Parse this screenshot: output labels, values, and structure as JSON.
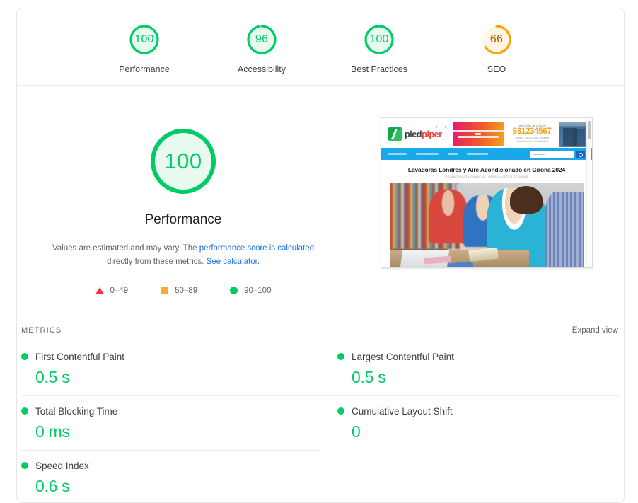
{
  "categories": [
    {
      "label": "Performance",
      "score": "100",
      "value": 100,
      "color": "#0c6",
      "track": "#e8f9ef"
    },
    {
      "label": "Accessibility",
      "score": "96",
      "value": 96,
      "color": "#0c6",
      "track": "#e8f9ef"
    },
    {
      "label": "Best Practices",
      "score": "100",
      "value": 100,
      "color": "#0c6",
      "track": "#e8f9ef"
    },
    {
      "label": "SEO",
      "score": "66",
      "value": 66,
      "color": "#ffa400",
      "track": "#fff6e5"
    }
  ],
  "summary": {
    "score": "100",
    "label": "Performance",
    "note_part1": "Values are estimated and may vary. The ",
    "note_link1": "performance score is calculated",
    "note_part2": " directly from these metrics. ",
    "note_link2": "See calculator.",
    "legend": [
      {
        "icon": "triangle-red-icon",
        "range": "0–49",
        "color": "#f33"
      },
      {
        "icon": "square-orange-icon",
        "range": "50–89",
        "color": "#fa3"
      },
      {
        "icon": "circle-green-icon",
        "range": "90–100",
        "color": "#0c6"
      }
    ]
  },
  "screenshot": {
    "logo_first": "pied",
    "logo_second": "piper",
    "contact_heading": "Atención al cliente",
    "contact_phone": "931234567",
    "contact_address_line1": "Horario : M-DIGITAL Terrassa",
    "contact_address_line2": "Instalacion Libre de Cataluña",
    "page_title": "Lavadoras Londres y Aire Acondicionado en Girona 2024",
    "page_subtitle": "COLABORACIÓN FINANCIAL, OFERTAS MEDIA SEMANAS"
  },
  "metrics_section": {
    "title": "METRICS",
    "expand_label": "Expand view",
    "items": [
      {
        "name": "First Contentful Paint",
        "value": "0.5 s",
        "status_color": "#0c6"
      },
      {
        "name": "Largest Contentful Paint",
        "value": "0.5 s",
        "status_color": "#0c6"
      },
      {
        "name": "Total Blocking Time",
        "value": "0 ms",
        "status_color": "#0c6"
      },
      {
        "name": "Cumulative Layout Shift",
        "value": "0",
        "status_color": "#0c6"
      },
      {
        "name": "Speed Index",
        "value": "0.6 s",
        "status_color": "#0c6"
      }
    ]
  }
}
